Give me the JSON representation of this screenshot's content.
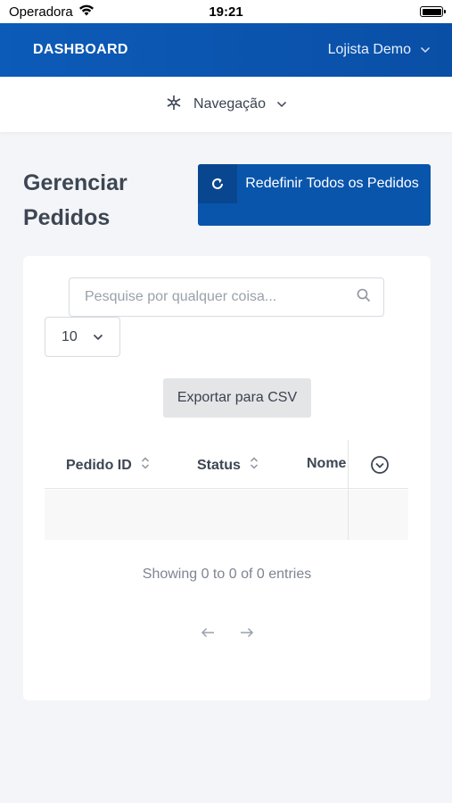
{
  "status_bar": {
    "carrier": "Operadora",
    "time": "19:21"
  },
  "header": {
    "brand": "DASHBOARD",
    "user_name": "Lojista Demo"
  },
  "navigation": {
    "label": "Navegação"
  },
  "page": {
    "title": "Gerenciar Pedidos"
  },
  "actions": {
    "reset_all_label": "Redefinir Todos os Pedidos",
    "export_label": "Exportar para CSV"
  },
  "search": {
    "placeholder": "Pesquise por qualquer coisa..."
  },
  "page_size": {
    "selected": "10"
  },
  "table": {
    "columns": [
      "Pedido ID",
      "Status",
      "Nome"
    ],
    "rows": []
  },
  "pagination": {
    "info": "Showing 0 to 0 of 0 entries"
  },
  "colors": {
    "primary": "#0a55ac",
    "topbar": "#0c5bb8"
  }
}
